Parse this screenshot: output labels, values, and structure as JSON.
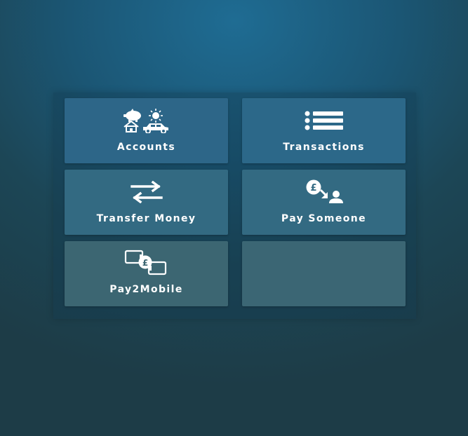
{
  "menu": {
    "tiles": [
      {
        "label": "Accounts",
        "icon": "accounts-icon"
      },
      {
        "label": "Transactions",
        "icon": "list-icon"
      },
      {
        "label": "Transfer Money",
        "icon": "transfer-arrows-icon"
      },
      {
        "label": "Pay Someone",
        "icon": "pay-someone-icon"
      },
      {
        "label": "Pay2Mobile",
        "icon": "pay2mobile-icon"
      }
    ]
  },
  "colors": {
    "background_top": "#1f6c93",
    "background_bottom": "#1d3c47",
    "tile": "#2d6688",
    "text": "#ffffff"
  }
}
